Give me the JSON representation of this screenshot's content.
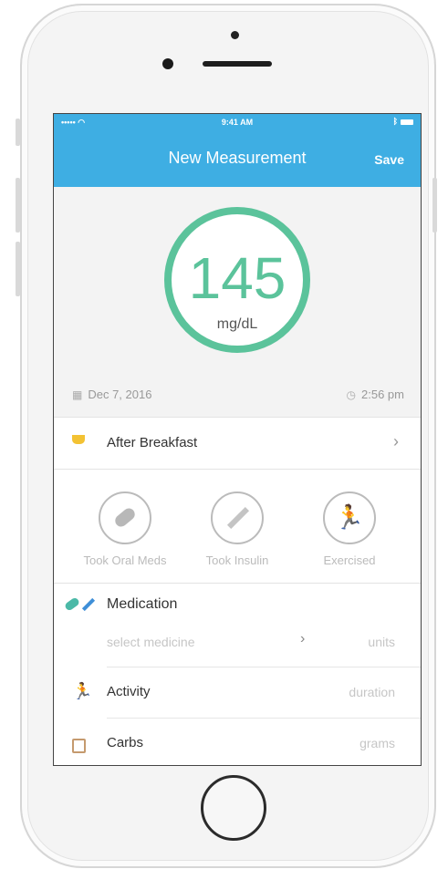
{
  "status": {
    "signal": "•••••",
    "time": "9:41 AM"
  },
  "nav": {
    "title": "New Measurement",
    "save": "Save"
  },
  "reading": {
    "value": "145",
    "unit": "mg/dL",
    "date": "Dec 7, 2016",
    "time": "2:56 pm"
  },
  "meal": {
    "label": "After Breakfast"
  },
  "actions": [
    {
      "label": "Took Oral Meds",
      "icon": "pill-icon"
    },
    {
      "label": "Took Insulin",
      "icon": "syringe-icon"
    },
    {
      "label": "Exercised",
      "icon": "runner-icon"
    }
  ],
  "medication": {
    "label": "Medication",
    "placeholder": "select medicine",
    "units": "units"
  },
  "activity": {
    "label": "Activity",
    "hint": "duration"
  },
  "carbs": {
    "label": "Carbs",
    "hint": "grams"
  },
  "colors": {
    "accent": "#3eaee3",
    "ring": "#5bc39b"
  }
}
